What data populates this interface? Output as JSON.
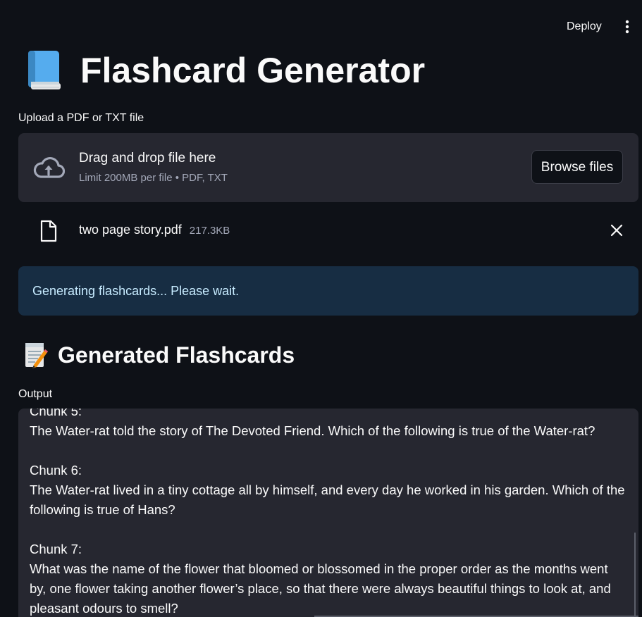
{
  "header": {
    "deploy_label": "Deploy",
    "menu_icon": "more-vertical-icon"
  },
  "title": {
    "emoji_icon": "blue-book-icon",
    "text": "Flashcard Generator"
  },
  "uploader": {
    "label": "Upload a PDF or TXT file",
    "icon": "cloud-upload-icon",
    "drag_text": "Drag and drop file here",
    "limit_text": "Limit 200MB per file • PDF, TXT",
    "browse_label": "Browse files"
  },
  "uploaded_file": {
    "icon": "file-icon",
    "name": "two page story.pdf",
    "size": "217.3KB",
    "remove_icon": "close-icon"
  },
  "info": {
    "text": "Generating flashcards... Please wait."
  },
  "section": {
    "emoji_icon": "memo-icon",
    "title": "Generated Flashcards"
  },
  "output": {
    "label": "Output",
    "text": "Chunk 5:\nThe Water-rat told the story of The Devoted Friend. Which of the following is true of the Water-rat?\n\nChunk 6:\nThe Water-rat lived in a tiny cottage all by himself, and every day he worked in his garden. Which of the following is true of Hans?\n\nChunk 7:\nWhat was the name of the flower that bloomed or blossomed in the proper order as the months went by, one flower taking another flower’s place, so that there were always beautiful things to look at, and pleasant odours to smell?"
  },
  "colors": {
    "background": "#0e1117",
    "panel": "#262730",
    "info_background": "#172d43",
    "info_text": "#c7ebff",
    "muted_text": "#a3a8b8"
  }
}
